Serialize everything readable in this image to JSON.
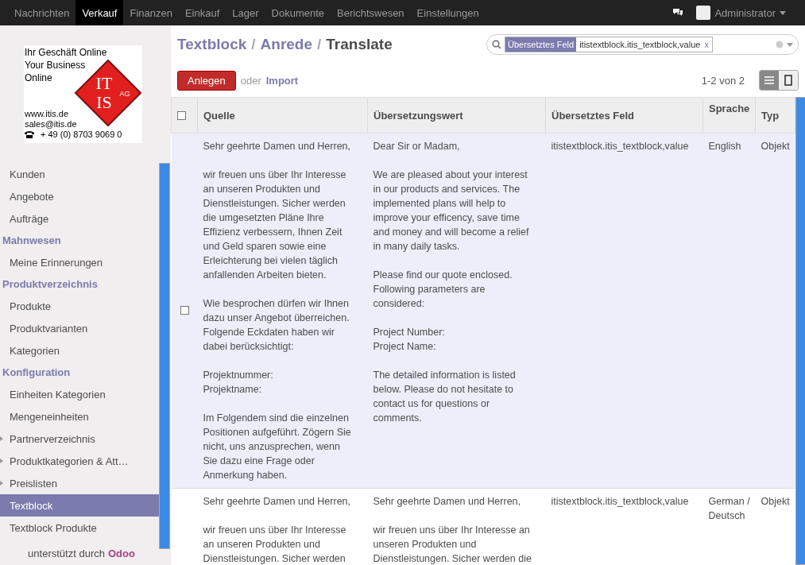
{
  "topnav": {
    "items": [
      {
        "label": "Nachrichten",
        "selected": false
      },
      {
        "label": "Verkauf",
        "selected": true
      },
      {
        "label": "Finanzen",
        "selected": false
      },
      {
        "label": "Einkauf",
        "selected": false
      },
      {
        "label": "Lager",
        "selected": false
      },
      {
        "label": "Dokumente",
        "selected": false
      },
      {
        "label": "Berichtswesen",
        "selected": false
      },
      {
        "label": "Einstellungen",
        "selected": false
      }
    ],
    "user": "Administrator"
  },
  "logo": {
    "slogan": [
      "Ihr Geschäft Online",
      "Your Business",
      "Online"
    ],
    "mark_top": "IT",
    "mark_bottom": "IS",
    "mark_suffix": "AG",
    "contact": [
      "www.itis.de",
      "sales@itis.de"
    ],
    "phone": "+ 49 (0) 8703 9069 0"
  },
  "sidebar": {
    "items": [
      {
        "kind": "item",
        "label": "Kunden",
        "selected": false
      },
      {
        "kind": "item",
        "label": "Angebote",
        "selected": false
      },
      {
        "kind": "item",
        "label": "Aufträge",
        "selected": false
      },
      {
        "kind": "header",
        "label": "Mahnwesen"
      },
      {
        "kind": "item",
        "label": "Meine Erinnerungen",
        "selected": false
      },
      {
        "kind": "header",
        "label": "Produktverzeichnis"
      },
      {
        "kind": "item",
        "label": "Produkte",
        "selected": false
      },
      {
        "kind": "item",
        "label": "Produktvarianten",
        "selected": false
      },
      {
        "kind": "item",
        "label": "Kategorien",
        "selected": false
      },
      {
        "kind": "header",
        "label": "Konfiguration"
      },
      {
        "kind": "item",
        "label": "Einheiten Kategorien",
        "selected": false
      },
      {
        "kind": "item",
        "label": "Mengeneinheiten",
        "selected": false
      },
      {
        "kind": "folder",
        "label": "Partnerverzeichnis",
        "selected": false
      },
      {
        "kind": "folder",
        "label": "Produktkategorien & Att…",
        "selected": false
      },
      {
        "kind": "folder",
        "label": "Preislisten",
        "selected": false
      },
      {
        "kind": "item",
        "label": "Textblock",
        "selected": true
      },
      {
        "kind": "item",
        "label": "Textblock Produkte",
        "selected": false
      }
    ],
    "footer": "unterstützt durch",
    "footer_link": "Odoo"
  },
  "breadcrumb_separator": "/",
  "breadcrumb": [
    {
      "label": "Textblock",
      "kind": "link"
    },
    {
      "label": "Anrede",
      "kind": "link"
    },
    {
      "label": "Translate",
      "kind": "current"
    }
  ],
  "search": {
    "facet_label": "Übersetztes Feld",
    "facet_value": "itistextblock.itis_textblock,value",
    "facet_remove": "x"
  },
  "toolbar": {
    "create": "Anlegen",
    "or": "oder",
    "import": "Import",
    "pager": "1-2 von 2",
    "views": [
      {
        "kind": "list",
        "selected": true
      },
      {
        "kind": "form",
        "selected": false
      }
    ]
  },
  "table": {
    "select_all_checked": false,
    "columns": [
      "Quelle",
      "Übersetzungswert",
      "Übersetztes Feld",
      "Sprache",
      "Typ"
    ],
    "rows": [
      {
        "highlighted": true,
        "checked": false,
        "cells": [
          "Sehr geehrte Damen und Herren,\n\nwir freuen uns über Ihr Interesse\nan unseren Produkten und\nDienstleistungen. Sicher werden\ndie umgesetzten Pläne Ihre\nEffizienz verbessern, Ihnen Zeit\nund Geld sparen sowie eine\nErleichterung bei vielen täglich\nanfallenden Arbeiten bieten.\n\nWie besprochen dürfen wir Ihnen\ndazu unser Angebot überreichen.\nFolgende Eckdaten haben wir\ndabei berücksichtigt:\n\nProjektnummer:\nProjektname:\n\nIm Folgendem sind die einzelnen\nPositionen aufgeführt. Zögern Sie\nnicht, uns anzusprechen, wenn\nSie dazu eine Frage oder\nAnmerkung haben.",
          "Dear Sir or Madam,\n\nWe are pleased about your interest\nin our products and services. The\nimplemented plans will help to\nimprove your efficency, save time\nand money and will become a relief\nin many daily tasks.\n\nPlease find our quote enclosed.\nFollowing parameters are\nconsidered:\n\nProject Number:\nProject Name:\n\nThe detailed information is listed\nbelow. Please do not hesitate to\ncontact us for questions or\ncomments.",
          "itistextblock.itis_textblock,value",
          "English",
          "Objekt"
        ]
      },
      {
        "highlighted": false,
        "cells": [
          "Sehr geehrte Damen und Herren,\n\nwir freuen uns über Ihr Interesse\nan unseren Produkten und\nDienstleistungen. Sicher werden",
          "Sehr geehrte Damen und Herren,\n\nwir freuen uns über Ihr Interesse an\nunseren Produkten und\nDienstleistungen. Sicher werden die",
          "itistextblock.itis_textblock,value",
          "German /\nDeutsch",
          "Objekt"
        ]
      }
    ]
  }
}
